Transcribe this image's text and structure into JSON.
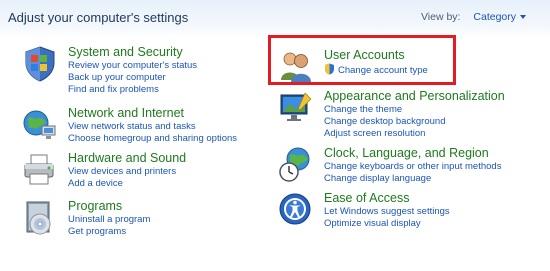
{
  "header": {
    "title": "Adjust your computer's settings",
    "view_by_label": "View by:",
    "view_by_value": "Category"
  },
  "left_column": [
    {
      "title": "System and Security",
      "icon": "shield-flag-icon",
      "links": [
        "Review your computer's status",
        "Back up your computer",
        "Find and fix problems"
      ]
    },
    {
      "title": "Network and Internet",
      "icon": "network-globe-icon",
      "links": [
        "View network status and tasks",
        "Choose homegroup and sharing options"
      ]
    },
    {
      "title": "Hardware and Sound",
      "icon": "printer-icon",
      "links": [
        "View devices and printers",
        "Add a device"
      ]
    },
    {
      "title": "Programs",
      "icon": "programs-disc-icon",
      "links": [
        "Uninstall a program",
        "Get programs"
      ]
    }
  ],
  "right_column": [
    {
      "title": "User Accounts",
      "icon": "users-icon",
      "links": [
        "Change account type"
      ],
      "highlighted": true
    },
    {
      "title": "Appearance and Personalization",
      "icon": "display-paint-icon",
      "links": [
        "Change the theme",
        "Change desktop background",
        "Adjust screen resolution"
      ]
    },
    {
      "title": "Clock, Language, and Region",
      "icon": "clock-globe-icon",
      "links": [
        "Change keyboards or other input methods",
        "Change display language"
      ]
    },
    {
      "title": "Ease of Access",
      "icon": "ease-of-access-icon",
      "links": [
        "Let Windows suggest settings",
        "Optimize visual display"
      ]
    }
  ],
  "colors": {
    "category_title": "#1e7a1e",
    "link": "#1b56b5",
    "highlight_border": "#e31b23"
  }
}
